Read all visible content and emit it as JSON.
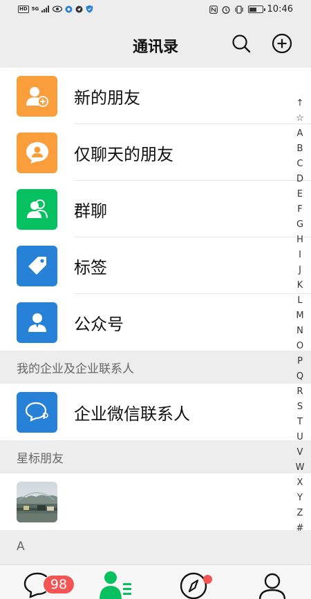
{
  "status": {
    "left_pill": "HD",
    "left_net": "5G",
    "time": "10:46"
  },
  "nav": {
    "title": "通讯录"
  },
  "entries": [
    {
      "label": "新的朋友",
      "color": "#fa9d3b"
    },
    {
      "label": "仅聊天的朋友",
      "color": "#fa9d3b"
    },
    {
      "label": "群聊",
      "color": "#07c160"
    },
    {
      "label": "标签",
      "color": "#2782d7"
    },
    {
      "label": "公众号",
      "color": "#2782d7"
    }
  ],
  "sections": {
    "enterprise_header": "我的企业及企业联系人",
    "enterprise_item": "企业微信联系人",
    "starred_header": "星标朋友",
    "a_header": "A"
  },
  "index_letters": [
    "↑",
    "☆",
    "A",
    "B",
    "C",
    "D",
    "E",
    "F",
    "G",
    "H",
    "I",
    "J",
    "K",
    "L",
    "M",
    "N",
    "O",
    "P",
    "Q",
    "R",
    "S",
    "T",
    "U",
    "V",
    "W",
    "X",
    "Y",
    "Z",
    "#"
  ],
  "tabbar": {
    "chats_badge": "98"
  },
  "colors": {
    "accent_green": "#07c160",
    "badge_red": "#f35454"
  }
}
